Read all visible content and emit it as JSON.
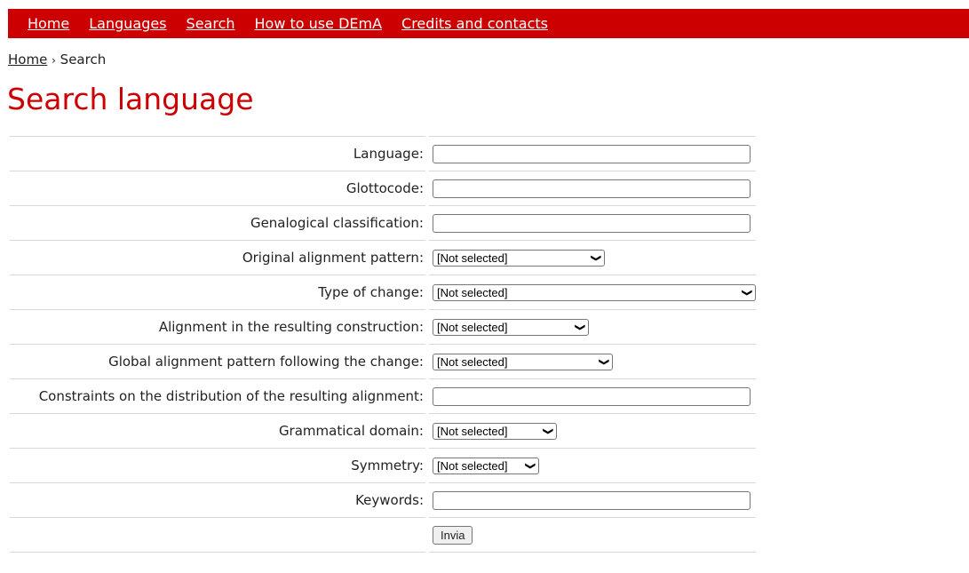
{
  "nav": {
    "items": [
      "Home",
      "Languages",
      "Search",
      "How to use DEmA",
      "Credits and contacts"
    ]
  },
  "breadcrumb": {
    "home": "Home",
    "separator": "›",
    "current": "Search"
  },
  "page_title": "Search language",
  "form": {
    "language_label": "Language:",
    "glottocode_label": "Glottocode:",
    "genealogical_label": "Genalogical classification:",
    "original_alignment_label": "Original alignment pattern:",
    "original_alignment_value": "[Not selected]",
    "type_of_change_label": "Type of change:",
    "type_of_change_value": "[Not selected]",
    "resulting_alignment_label": "Alignment in the resulting construction:",
    "resulting_alignment_value": "[Not selected]",
    "global_alignment_label": "Global alignment pattern following the change:",
    "global_alignment_value": "[Not selected]",
    "constraints_label": "Constraints on the distribution of the resulting alignment:",
    "grammatical_domain_label": "Grammatical domain:",
    "grammatical_domain_value": "[Not selected]",
    "symmetry_label": "Symmetry:",
    "symmetry_value": "[Not selected]",
    "keywords_label": "Keywords:",
    "submit_label": "Invia"
  },
  "colors": {
    "accent": "#cc0000",
    "border": "#d8d8d8"
  }
}
